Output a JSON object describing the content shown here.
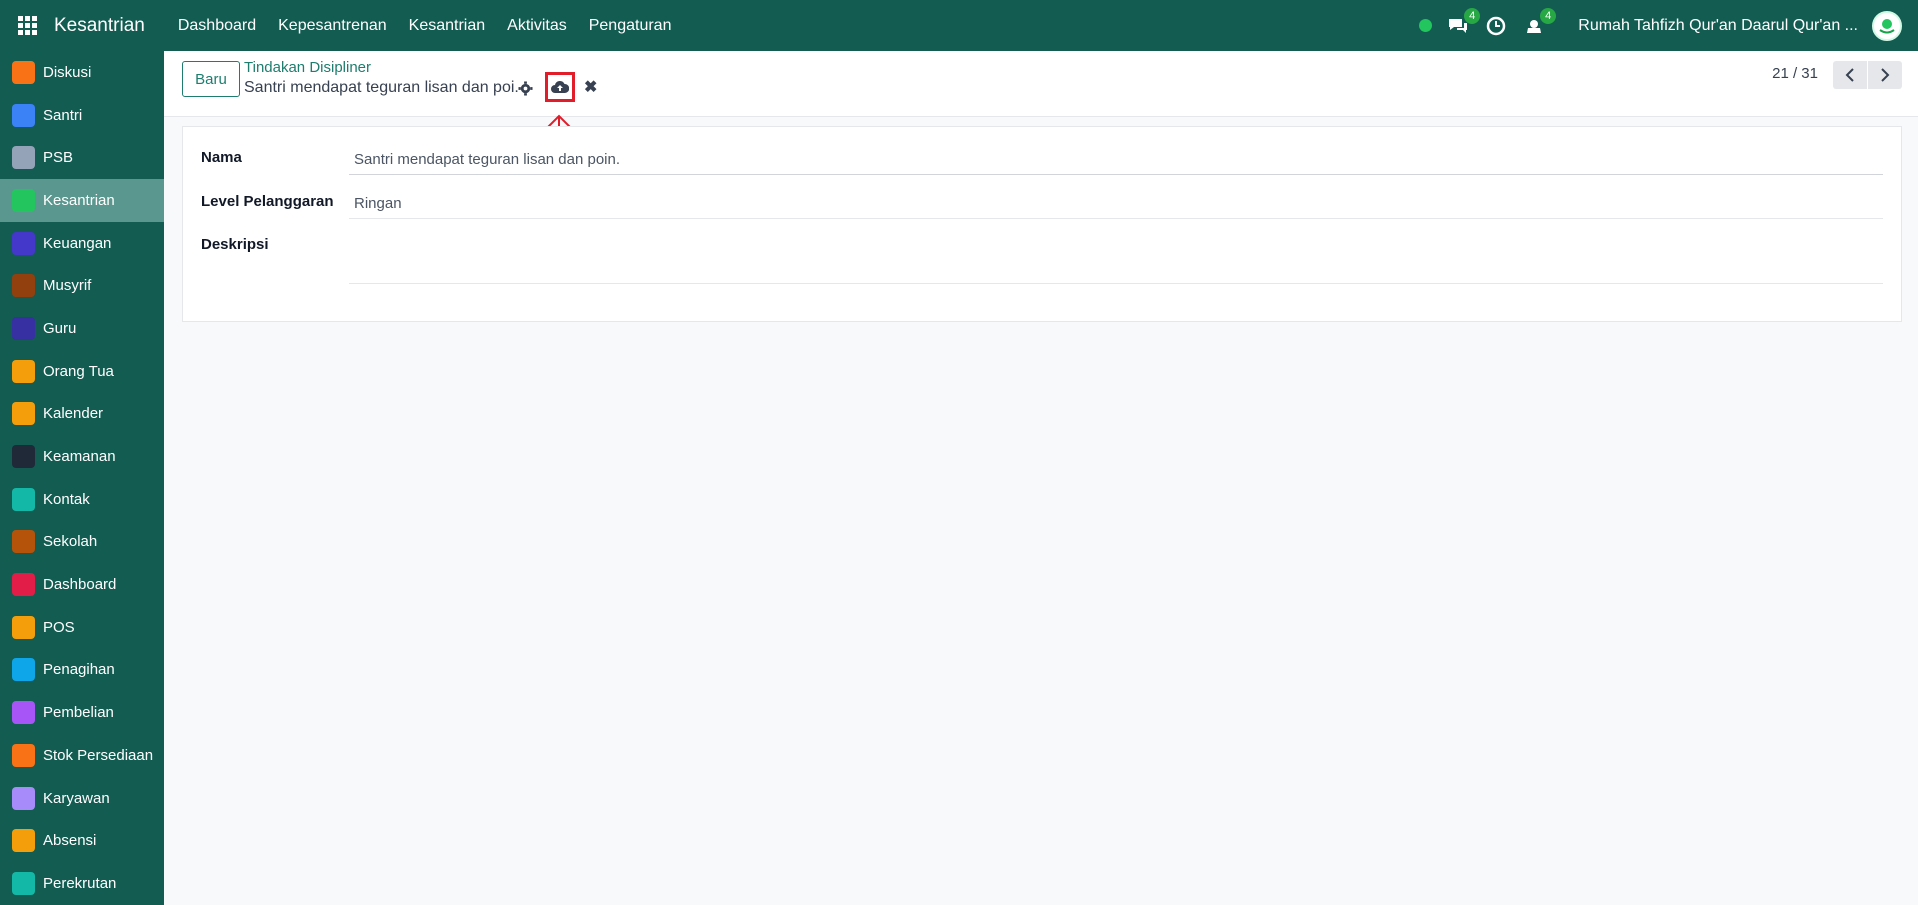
{
  "topbar": {
    "brand": "Kesantrian",
    "nav": [
      "Dashboard",
      "Kepesantrenan",
      "Kesantrian",
      "Aktivitas",
      "Pengaturan"
    ],
    "messages_badge": "4",
    "activity_badge": "4",
    "company": "Rumah Tahfizh Qur'an Daarul Qur'an ..."
  },
  "sidebar": {
    "items": [
      {
        "label": "Diskusi",
        "color": "#f97316"
      },
      {
        "label": "Santri",
        "color": "#3b82f6"
      },
      {
        "label": "PSB",
        "color": "#94a3b8"
      },
      {
        "label": "Kesantrian",
        "color": "#22c55e"
      },
      {
        "label": "Keuangan",
        "color": "#4338ca"
      },
      {
        "label": "Musyrif",
        "color": "#92400e"
      },
      {
        "label": "Guru",
        "color": "#3730a3"
      },
      {
        "label": "Orang Tua",
        "color": "#f59e0b"
      },
      {
        "label": "Kalender",
        "color": "#f59e0b"
      },
      {
        "label": "Keamanan",
        "color": "#1f2937"
      },
      {
        "label": "Kontak",
        "color": "#14b8a6"
      },
      {
        "label": "Sekolah",
        "color": "#b45309"
      },
      {
        "label": "Dashboard",
        "color": "#e11d48"
      },
      {
        "label": "POS",
        "color": "#f59e0b"
      },
      {
        "label": "Penagihan",
        "color": "#0ea5e9"
      },
      {
        "label": "Pembelian",
        "color": "#a855f7"
      },
      {
        "label": "Stok Persediaan",
        "color": "#f97316"
      },
      {
        "label": "Karyawan",
        "color": "#a78bfa"
      },
      {
        "label": "Absensi",
        "color": "#f59e0b"
      },
      {
        "label": "Perekrutan",
        "color": "#14b8a6"
      }
    ],
    "active_index": 3
  },
  "control": {
    "new_label": "Baru",
    "breadcrumb": "Tindakan Disipliner",
    "record_title": "Santri mendapat teguran lisan dan poi.",
    "pager": "21 / 31"
  },
  "form": {
    "nama_label": "Nama",
    "nama_value": "Santri mendapat teguran lisan dan poin.",
    "level_label": "Level Pelanggaran",
    "level_value": "Ringan",
    "deskripsi_label": "Deskripsi",
    "deskripsi_value": ""
  }
}
